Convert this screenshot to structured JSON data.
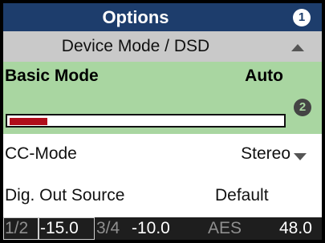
{
  "header": {
    "title": "Options",
    "badge": "1"
  },
  "section": {
    "label": "Device Mode / DSD"
  },
  "basic_mode": {
    "label": "Basic Mode",
    "value": "Auto",
    "badge": "2",
    "level_fraction": 0.14
  },
  "cc_mode": {
    "label": "CC-Mode",
    "value": "Stereo"
  },
  "dig_out": {
    "label": "Dig. Out Source",
    "value": "Default"
  },
  "status_bar": {
    "ch12_label": "1/2",
    "ch12_value": "-15.0",
    "ch34_label": "3/4",
    "ch34_value": "-10.0",
    "aes_label": "AES",
    "aes_value": "48.0"
  },
  "colors": {
    "header_bg": "#1d3d6c",
    "section_bg": "#c9c9c9",
    "selected_bg": "#a9d6a1",
    "meter_fill": "#b00e1b",
    "status_bg": "#1e1e1e"
  },
  "icons": {
    "section_arrow": "triangle-up-icon",
    "cc_arrow": "triangle-down-icon"
  }
}
